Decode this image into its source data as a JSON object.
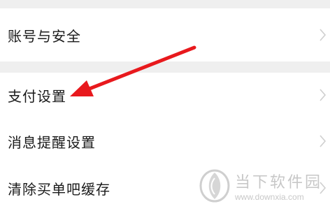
{
  "settings": {
    "items": [
      {
        "label": "账号与安全"
      },
      {
        "label": "支付设置"
      },
      {
        "label": "消息提醒设置"
      },
      {
        "label": "清除买单吧缓存"
      }
    ]
  },
  "annotation": {
    "arrow_color": "#e8191d",
    "icon": "arrow-icon"
  },
  "watermark": {
    "title": "当下软件园",
    "url": "www.downxia.com",
    "icon": "downxia-logo-icon"
  }
}
